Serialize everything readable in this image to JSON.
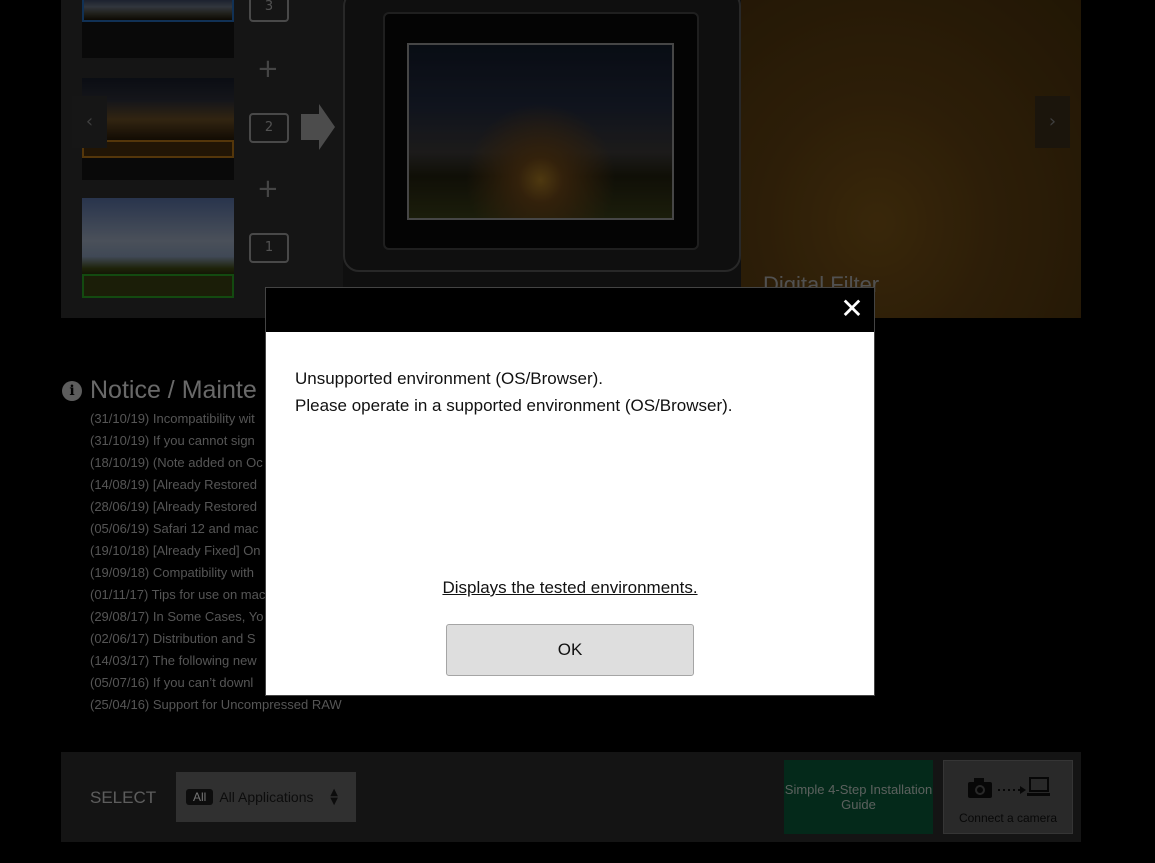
{
  "hero": {
    "prev_arrow": "‹",
    "next_arrow": "›",
    "badges": [
      "3",
      "2",
      "1"
    ],
    "plus_sign": "+",
    "right_panel_caption": "Digital Filter"
  },
  "notice": {
    "heading": "Notice / Mainte",
    "items": [
      "(31/10/19) Incompatibility wit",
      "(31/10/19) If you cannot sign",
      "(18/10/19) (Note added on Oc",
      "(14/08/19) [Already Restored",
      "(28/06/19) [Already Restored",
      "(05/06/19) Safari 12 and mac",
      "(19/10/18) [Already Fixed] On",
      "(19/09/18) Compatibility with",
      "(01/11/17) Tips for use on mac",
      "(29/08/17) In Some Cases, Yo",
      "(02/06/17) Distribution and S",
      "(14/03/17) The following new",
      "(05/07/16) If you can’t downl",
      "(25/04/16) Support for Uncompressed RAW"
    ]
  },
  "bottom_bar": {
    "select_label": "SELECT",
    "all_tag": "All",
    "select_value": "All Applications",
    "guide_label": "Simple 4-Step Installation Guide",
    "connect_label": "Connect a camera"
  },
  "modal": {
    "close_glyph": "✕",
    "line1": "Unsupported environment (OS/Browser).",
    "line2": "Please operate in a supported environment (OS/Browser).",
    "link_text": "Displays the tested environments.",
    "ok_label": "OK"
  }
}
